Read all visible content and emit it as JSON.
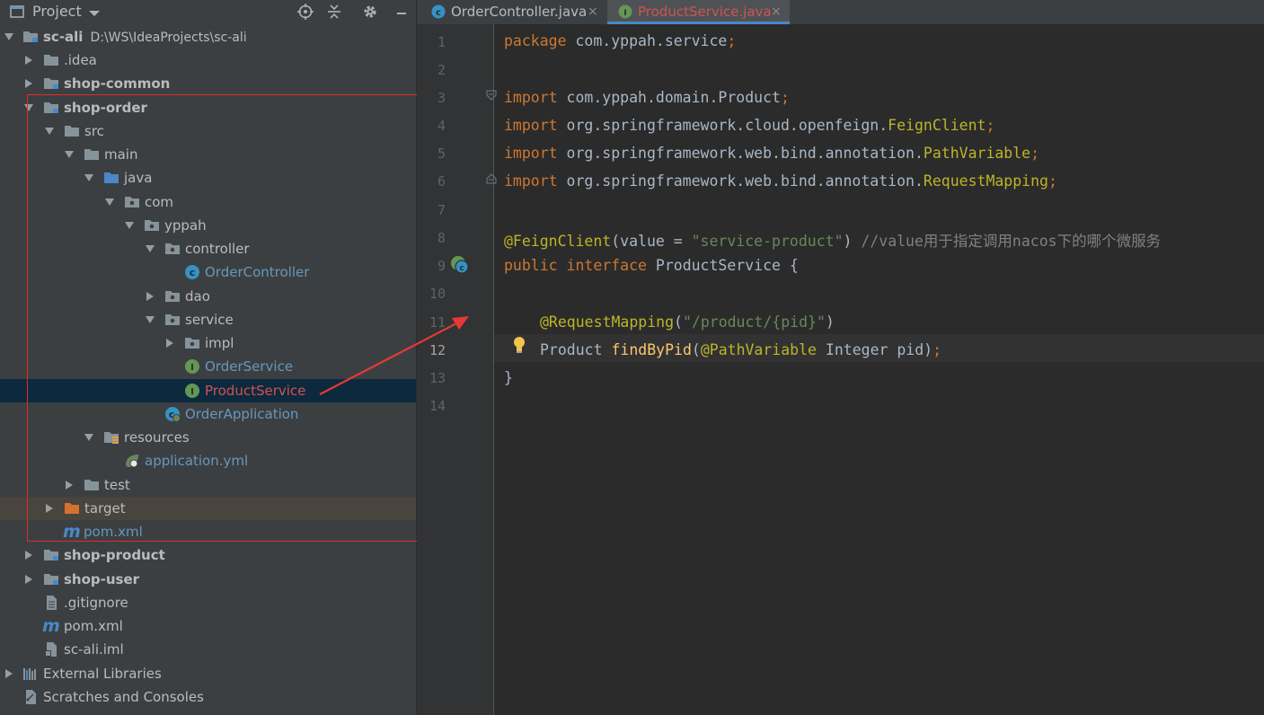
{
  "sidebar": {
    "title": "Project",
    "tree": [
      {
        "label": "sc-ali",
        "path": "D:\\WS\\IdeaProjects\\sc-ali",
        "bold": true
      },
      {
        "label": ".idea"
      },
      {
        "label": "shop-common",
        "bold": true
      },
      {
        "label": "shop-order",
        "bold": true
      },
      {
        "label": "src"
      },
      {
        "label": "main"
      },
      {
        "label": "java"
      },
      {
        "label": "com"
      },
      {
        "label": "yppah"
      },
      {
        "label": "controller"
      },
      {
        "label": "OrderController"
      },
      {
        "label": "dao"
      },
      {
        "label": "service"
      },
      {
        "label": "impl"
      },
      {
        "label": "OrderService"
      },
      {
        "label": "ProductService"
      },
      {
        "label": "OrderApplication"
      },
      {
        "label": "resources"
      },
      {
        "label": "application.yml"
      },
      {
        "label": "test"
      },
      {
        "label": "target"
      },
      {
        "label": "pom.xml"
      },
      {
        "label": "shop-product",
        "bold": true
      },
      {
        "label": "shop-user",
        "bold": true
      },
      {
        "label": ".gitignore"
      },
      {
        "label": "pom.xml"
      },
      {
        "label": "sc-ali.iml"
      },
      {
        "label": "External Libraries"
      },
      {
        "label": "Scratches and Consoles"
      }
    ]
  },
  "tabs": [
    {
      "label": "OrderController.java",
      "close": "×"
    },
    {
      "label": "ProductService.java",
      "close": "×",
      "active": true
    }
  ],
  "editor": {
    "line_numbers": [
      "1",
      "2",
      "3",
      "4",
      "5",
      "6",
      "7",
      "8",
      "9",
      "10",
      "11",
      "12",
      "13",
      "14"
    ],
    "current_line": 12,
    "lines": {
      "l1": {
        "kw": "package",
        "rest": " com.yppah.service",
        "semi": ";"
      },
      "l3": {
        "kw": "import",
        "rest": " com.yppah.domain.Product",
        "semi": ";"
      },
      "l4": {
        "kw": "import",
        "rest": " org.springframework.cloud.openfeign.",
        "cls": "FeignClient",
        "semi": ";"
      },
      "l5": {
        "kw": "import",
        "rest": " org.springframework.web.bind.annotation.",
        "cls": "PathVariable",
        "semi": ";"
      },
      "l6": {
        "kw": "import",
        "rest": " org.springframework.web.bind.annotation.",
        "cls": "RequestMapping",
        "semi": ";"
      },
      "l8": {
        "ann": "@FeignClient",
        "open": "(value = ",
        "str": "\"service-product\"",
        "close": ") ",
        "comment": "//value用于指定调用nacos下的哪个微服务"
      },
      "l9": {
        "kw1": "public",
        "kw2": "interface",
        "name": " ProductService {"
      },
      "l11": {
        "ann": "@RequestMapping",
        "open": "(",
        "str": "\"/product/{pid}\"",
        "close": ")"
      },
      "l12": {
        "type": "Product ",
        "fn": "findByPid",
        "open": "(",
        "ann": "@PathVariable",
        "rest": " Integer pid)",
        "semi": ";"
      },
      "l13": {
        "text": "}"
      }
    }
  },
  "colors": {
    "highlight_box": "#e02b2b",
    "arrow": "#e53935",
    "selection": "#0d293e",
    "keyword": "#cc7832",
    "annotation": "#bbb529",
    "string": "#6a8759",
    "comment": "#808080",
    "function": "#ffc66d"
  }
}
